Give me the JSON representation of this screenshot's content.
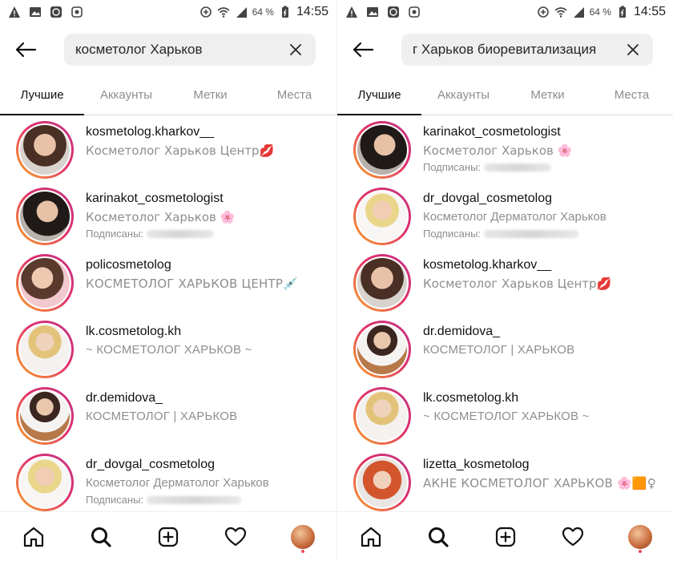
{
  "status": {
    "battery": "64 %",
    "time": "14:55"
  },
  "screens": [
    {
      "search": {
        "query": "косметолог Харьков"
      },
      "tabs": [
        {
          "label": "Лучшие",
          "active": true
        },
        {
          "label": "Аккаунты",
          "active": false
        },
        {
          "label": "Метки",
          "active": false
        },
        {
          "label": "Места",
          "active": false
        }
      ],
      "results": [
        {
          "username": "kosmetolog.kharkov__",
          "subtitle": "Косметолог Харьков Центр💋",
          "followed_by": ""
        },
        {
          "username": "karinakot_cosmetologist",
          "subtitle": "Косметолог Харьков 🌸",
          "followed_by": "Подписаны:"
        },
        {
          "username": "policosmetolog",
          "subtitle": "КОСМЕТОЛОГ ХАРЬКОВ ЦЕНТР💉",
          "followed_by": ""
        },
        {
          "username": "lk.cosmetolog.kh",
          "subtitle": "~ КОСМЕТОЛОГ ХАРЬКОВ ~",
          "followed_by": ""
        },
        {
          "username": "dr.demidova_",
          "subtitle": "КОСМЕТОЛОГ | ХАРЬКОВ",
          "followed_by": ""
        },
        {
          "username": "dr_dovgal_cosmetolog",
          "subtitle": "Косметолог Дерматолог Харьков",
          "followed_by": "Подписаны:"
        }
      ]
    },
    {
      "search": {
        "query": "г Харьков биоревитализация"
      },
      "tabs": [
        {
          "label": "Лучшие",
          "active": true
        },
        {
          "label": "Аккаунты",
          "active": false
        },
        {
          "label": "Метки",
          "active": false
        },
        {
          "label": "Места",
          "active": false
        }
      ],
      "results": [
        {
          "username": "karinakot_cosmetologist",
          "subtitle": "Косметолог Харьков 🌸",
          "followed_by": "Подписаны:"
        },
        {
          "username": "dr_dovgal_cosmetolog",
          "subtitle": "Косметолог Дерматолог Харьков",
          "followed_by": "Подписаны:"
        },
        {
          "username": "kosmetolog.kharkov__",
          "subtitle": "Косметолог Харьков Центр💋",
          "followed_by": ""
        },
        {
          "username": "dr.demidova_",
          "subtitle": "КОСМЕТОЛОГ | ХАРЬКОВ",
          "followed_by": ""
        },
        {
          "username": "lk.cosmetolog.kh",
          "subtitle": "~ КОСМЕТОЛОГ ХАРЬКОВ ~",
          "followed_by": ""
        },
        {
          "username": "lizetta_kosmetolog",
          "subtitle": "АКНЕ КОСМЕТОЛОГ ХАРЬКОВ 🌸🟧♀",
          "followed_by": ""
        }
      ]
    }
  ],
  "colors": {
    "ring_start": "#f9a825",
    "ring_end": "#c13584",
    "muted": "#8e8e8e",
    "notification": "#ed4956"
  }
}
